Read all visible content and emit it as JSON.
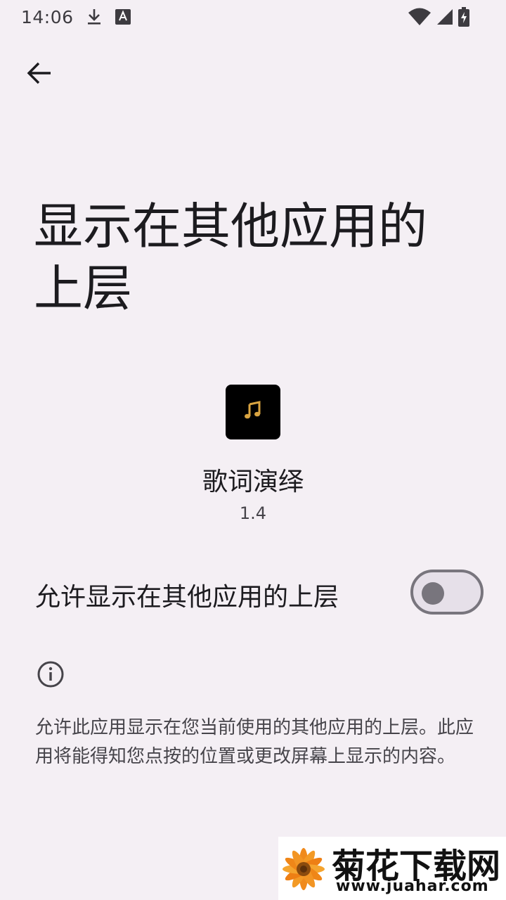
{
  "status_bar": {
    "time": "14:06",
    "icons": [
      "download-icon",
      "keyboard-a-icon",
      "wifi-icon",
      "cell-signal-icon",
      "battery-charging-icon"
    ]
  },
  "nav": {
    "back_icon": "arrow-back-icon"
  },
  "page": {
    "title": "显示在其他应用的上层"
  },
  "app": {
    "icon": "music-note-icon",
    "name": "歌词演绎",
    "version": "1.4"
  },
  "setting": {
    "label": "允许显示在其他应用的上层",
    "enabled": false
  },
  "info": {
    "icon": "info-icon",
    "description": "允许此应用显示在您当前使用的其他应用的上层。此应用将能得知您点按的位置或更改屏幕上显示的内容。"
  },
  "watermark": {
    "brand": "菊花下载网",
    "url": "www.juahar.com"
  },
  "colors": {
    "background": "#f4eff4",
    "text_primary": "#1c1b1f",
    "text_secondary": "#46444a",
    "toggle_outline": "#78757d",
    "app_icon_bg": "#000000",
    "app_icon_note": "#d9a441"
  }
}
